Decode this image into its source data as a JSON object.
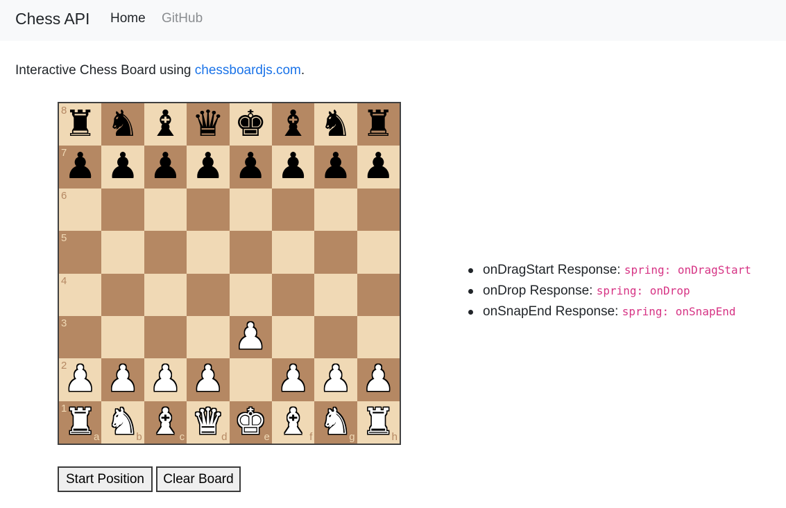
{
  "navbar": {
    "brand": "Chess API",
    "links": [
      {
        "label": "Home",
        "active": true
      },
      {
        "label": "GitHub",
        "active": false
      }
    ]
  },
  "intro": {
    "text": "Interactive Chess Board using ",
    "link_text": "chessboardjs.com",
    "suffix": "."
  },
  "board": {
    "colors": {
      "light": "#f0d9b5",
      "dark": "#b58863"
    },
    "rank_labels": [
      "8",
      "7",
      "6",
      "5",
      "4",
      "3",
      "2",
      "1"
    ],
    "file_labels": [
      "a",
      "b",
      "c",
      "d",
      "e",
      "f",
      "g",
      "h"
    ],
    "position": [
      [
        "bR",
        "bN",
        "bB",
        "bQ",
        "bK",
        "bB",
        "bN",
        "bR"
      ],
      [
        "bP",
        "bP",
        "bP",
        "bP",
        "bP",
        "bP",
        "bP",
        "bP"
      ],
      [
        "",
        "",
        "",
        "",
        "",
        "",
        "",
        ""
      ],
      [
        "",
        "",
        "",
        "",
        "",
        "",
        "",
        ""
      ],
      [
        "",
        "",
        "",
        "",
        "",
        "",
        "",
        ""
      ],
      [
        "",
        "",
        "",
        "",
        "wP",
        "",
        "",
        ""
      ],
      [
        "wP",
        "wP",
        "wP",
        "wP",
        "",
        "wP",
        "wP",
        "wP"
      ],
      [
        "wR",
        "wN",
        "wB",
        "wQ",
        "wK",
        "wB",
        "wN",
        "wR"
      ]
    ]
  },
  "responses": [
    {
      "label": "onDragStart Response: ",
      "value": "spring: onDragStart"
    },
    {
      "label": "onDrop Response: ",
      "value": "spring: onDrop"
    },
    {
      "label": "onSnapEnd Response: ",
      "value": "spring: onSnapEnd"
    }
  ],
  "buttons": {
    "start": "Start Position",
    "clear": "Clear Board"
  }
}
